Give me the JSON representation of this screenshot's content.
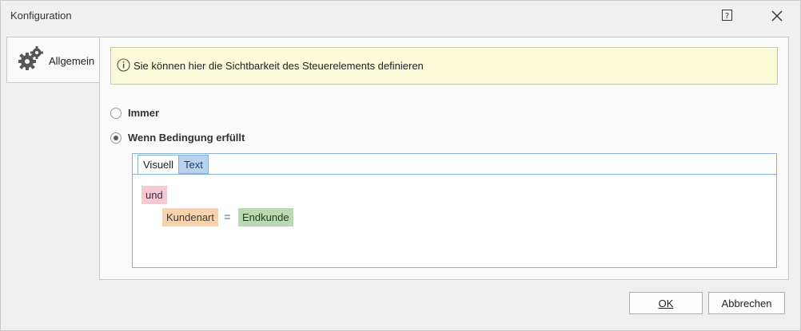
{
  "window": {
    "title": "Konfiguration",
    "help_icon": "help-icon",
    "close_icon": "close-icon"
  },
  "nav": {
    "tab_label": "Allgemein",
    "tab_icon": "gears-icon"
  },
  "info": {
    "icon": "info-icon",
    "text": "Sie können hier die Sichtbarkeit des Steuerelements definieren"
  },
  "visibility": {
    "options": [
      {
        "label": "Immer",
        "selected": false
      },
      {
        "label": "Wenn Bedingung erfüllt",
        "selected": true
      }
    ]
  },
  "condition": {
    "tabs": [
      {
        "label": "Visuell",
        "active": true
      },
      {
        "label": "Text",
        "active": false
      }
    ],
    "operator": "und",
    "field": "Kundenart",
    "comparator": "=",
    "value": "Endkunde"
  },
  "buttons": {
    "ok": "OK",
    "cancel": "Abbrechen"
  },
  "colors": {
    "info_bg": "#fbfbd9",
    "operator_token": "#f6c9d2",
    "field_token": "#f9d2ae",
    "value_token": "#b9d9b2",
    "active_tab_accent": "#b9d3ef"
  }
}
